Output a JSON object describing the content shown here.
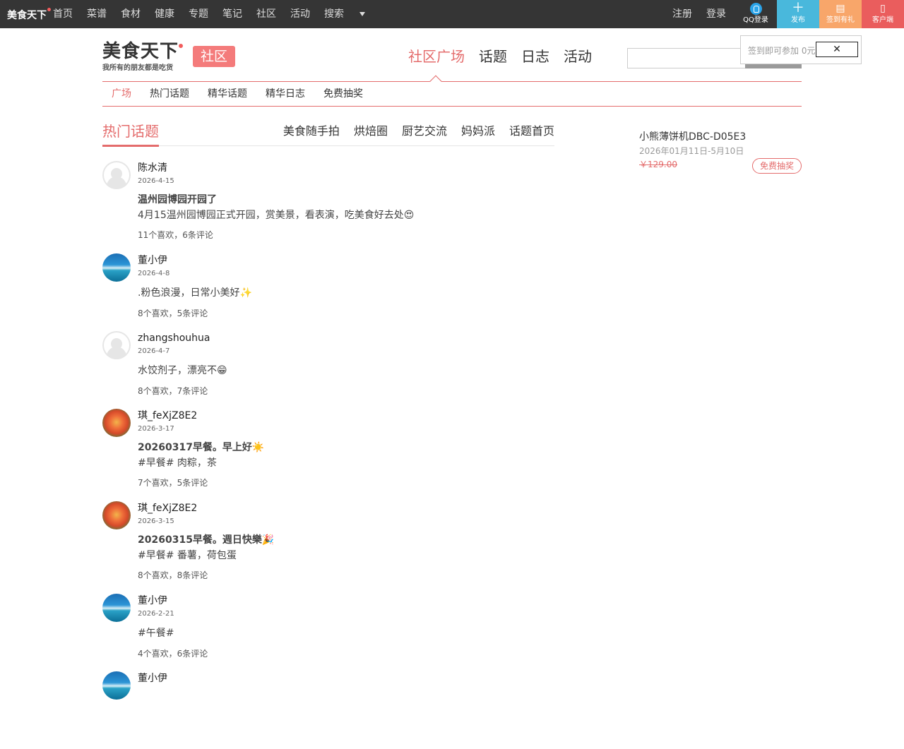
{
  "topbar": {
    "brand": "美食天下",
    "nav": [
      "首页",
      "菜谱",
      "食材",
      "健康",
      "专题",
      "笔记",
      "社区",
      "活动",
      "搜索"
    ],
    "register": "注册",
    "login": "登录",
    "qq_login": "QQ登录",
    "publish": "发布",
    "sign_gift": "签到有礼",
    "client": "客户端"
  },
  "header": {
    "logo_text": "美食天下",
    "logo_slogan": "我所有的朋友都是吃货",
    "community_badge": "社区",
    "main_nav": [
      "社区广场",
      "话题",
      "日志",
      "活动"
    ],
    "search": {
      "placeholder": ""
    },
    "popup": {
      "text": "签到即可参加 0元",
      "close_label": "✕"
    }
  },
  "subnav": [
    "广场",
    "热门话题",
    "精华话题",
    "精华日志",
    "免费抽奖"
  ],
  "section": {
    "title": "热门话题",
    "tabs": [
      "美食随手拍",
      "烘焙圈",
      "厨艺交流",
      "妈妈派",
      "话题首页"
    ]
  },
  "posts": [
    {
      "author": "陈水清",
      "date": "2026-4-15",
      "title": "温州园博园开园了",
      "body": "4月15温州园博园正式开园，赏美景，看表演，吃美食好去处😍",
      "meta": "11个喜欢，6条评论"
    },
    {
      "author": "董小伊",
      "date": "2026-4-8",
      "title": "",
      "body": ".粉色浪漫，日常小美好✨",
      "meta": "8个喜欢，5条评论"
    },
    {
      "author": "zhangshouhua",
      "date": "2026-4-7",
      "title": "",
      "body": "水饺剂子，漂亮不😁",
      "meta": "8个喜欢，7条评论"
    },
    {
      "author": "琪_feXjZ8E2",
      "date": "2026-3-17",
      "title": "20260317早餐。早上好☀️",
      "body": "#早餐# 肉粽，茶",
      "meta": "7个喜欢，5条评论"
    },
    {
      "author": "琪_feXjZ8E2",
      "date": "2026-3-15",
      "title": "20260315早餐。週日快樂🎉",
      "body": "#早餐# 番薯，荷包蛋",
      "meta": "8个喜欢，8条评论"
    },
    {
      "author": "董小伊",
      "date": "2026-2-21",
      "title": "",
      "body": "#午餐#",
      "meta": "4个喜欢，6条评论"
    },
    {
      "author": "董小伊",
      "date": "",
      "title": "",
      "body": "",
      "meta": ""
    }
  ],
  "sidebar": {
    "product_title": "小熊薄饼机DBC-D05E3",
    "product_date": "2026年01月11日-5月10日",
    "price": "￥129.00",
    "button": "免费抽奖"
  }
}
